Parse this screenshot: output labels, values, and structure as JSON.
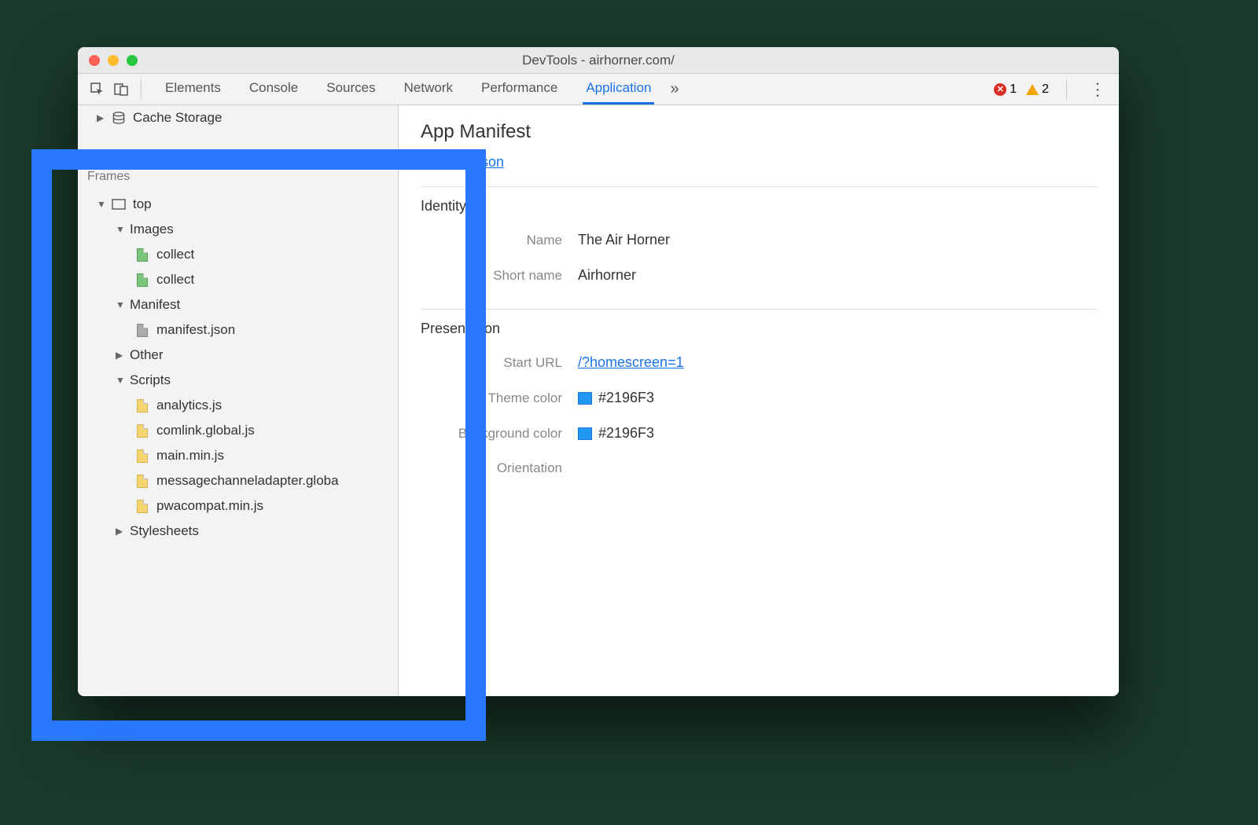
{
  "window": {
    "title": "DevTools - airhorner.com/"
  },
  "tabs": {
    "list": [
      "Elements",
      "Console",
      "Sources",
      "Network",
      "Performance",
      "Application"
    ],
    "active": 5,
    "more": "»",
    "errors": "1",
    "warnings": "2"
  },
  "sidebar": {
    "pre_section": "Cache Storage",
    "section_title": "Frames",
    "frames": {
      "top_label": "top",
      "groups": {
        "images": {
          "label": "Images",
          "items": [
            "collect",
            "collect"
          ]
        },
        "manifest": {
          "label": "Manifest",
          "items": [
            "manifest.json"
          ]
        },
        "other": {
          "label": "Other"
        },
        "scripts": {
          "label": "Scripts",
          "items": [
            "analytics.js",
            "comlink.global.js",
            "main.min.js",
            "messagechanneladapter.globa",
            "pwacompat.min.js"
          ]
        },
        "stylesheets": {
          "label": "Stylesheets"
        }
      }
    }
  },
  "manifest": {
    "heading": "App Manifest",
    "link": "manifest.json",
    "identity": {
      "title": "Identity",
      "name_label": "Name",
      "name_value": "The Air Horner",
      "short_name_label": "Short name",
      "short_name_value": "Airhorner"
    },
    "presentation": {
      "title": "Presentation",
      "start_url_label": "Start URL",
      "start_url_value": "/?homescreen=1",
      "theme_color_label": "Theme color",
      "theme_color_value": "#2196F3",
      "bg_color_label": "Background color",
      "bg_color_value": "#2196F3",
      "orientation_label": "Orientation"
    }
  }
}
